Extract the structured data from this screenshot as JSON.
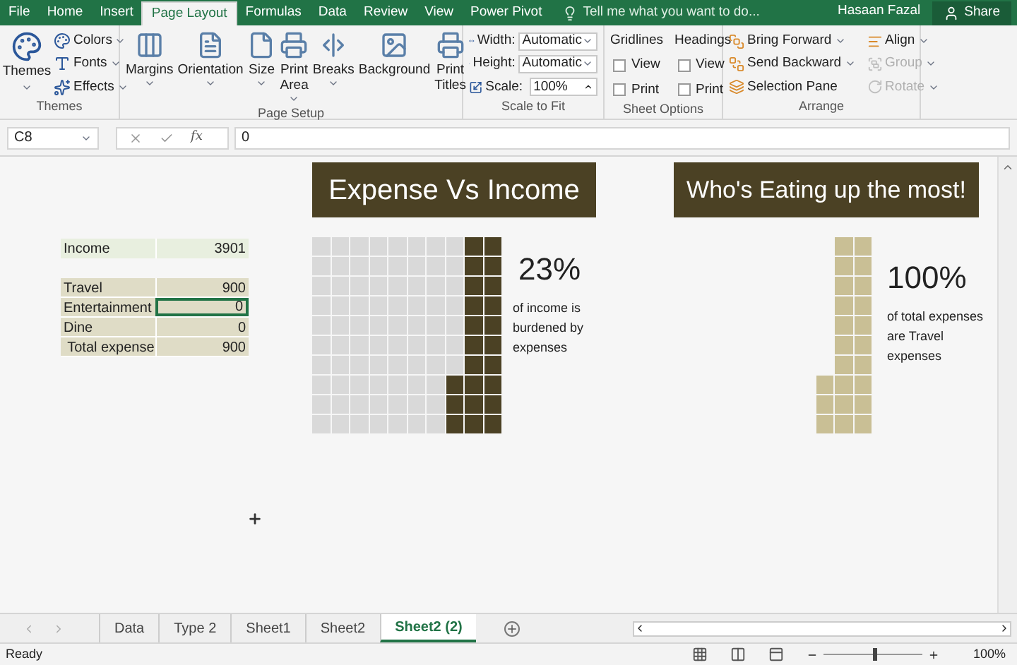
{
  "menu_tabs": [
    {
      "label": "File",
      "selected": false
    },
    {
      "label": "Home",
      "selected": false
    },
    {
      "label": "Insert",
      "selected": false
    },
    {
      "label": "Page Layout",
      "selected": true
    },
    {
      "label": "Formulas",
      "selected": false
    },
    {
      "label": "Data",
      "selected": false
    },
    {
      "label": "Review",
      "selected": false
    },
    {
      "label": "View",
      "selected": false
    },
    {
      "label": "Power Pivot",
      "selected": false
    }
  ],
  "tell_me": {
    "placeholder": "Tell me what you want to do..."
  },
  "user": "Hasaan Fazal",
  "share": "Share",
  "ribbon": {
    "themes": {
      "label": "Themes",
      "button": "Themes",
      "items": [
        "Colors",
        "Fonts",
        "Effects"
      ]
    },
    "page_setup": {
      "label": "Page Setup",
      "buttons": [
        {
          "label": "Margins",
          "dropdown": true
        },
        {
          "label": "Orientation",
          "dropdown": true
        },
        {
          "label": "Size",
          "dropdown": true
        },
        {
          "label": "Print Area",
          "dropdown": true
        },
        {
          "label": "Breaks",
          "dropdown": true
        },
        {
          "label": "Background",
          "dropdown": false
        },
        {
          "label": "Print Titles",
          "dropdown": false
        }
      ]
    },
    "scale_to_fit": {
      "label": "Scale to Fit",
      "rows": [
        {
          "kind": "select",
          "label": "Width:",
          "value": "Automatic"
        },
        {
          "kind": "select",
          "label": "Height:",
          "value": "Automatic"
        },
        {
          "kind": "spin",
          "label": "Scale:",
          "value": "100%"
        }
      ]
    },
    "sheet_options": {
      "label": "Sheet Options",
      "columns": [
        {
          "heading": "Gridlines",
          "options": [
            {
              "label": "View",
              "checked": false
            },
            {
              "label": "Print",
              "checked": false
            }
          ]
        },
        {
          "heading": "Headings",
          "options": [
            {
              "label": "View",
              "checked": false
            },
            {
              "label": "Print",
              "checked": false
            }
          ]
        }
      ]
    },
    "arrange": {
      "label": "Arrange",
      "items": [
        {
          "label": "Bring Forward",
          "disabled": false
        },
        {
          "label": "Send Backward",
          "disabled": false
        },
        {
          "label": "Selection Pane",
          "disabled": false
        },
        {
          "label": "Align",
          "disabled": false
        },
        {
          "label": "Group",
          "disabled": true
        },
        {
          "label": "Rotate",
          "disabled": true
        }
      ]
    }
  },
  "formula_bar": {
    "name_box": "C8",
    "function": "fx",
    "value": "0"
  },
  "table": {
    "income": {
      "label": "Income",
      "value": "3901"
    },
    "rows": [
      {
        "label": "Travel",
        "value": "900",
        "selected": false
      },
      {
        "label": "Entertainment",
        "value": "0",
        "selected": true
      },
      {
        "label": "Dine",
        "value": "0",
        "selected": false
      },
      {
        "label": " Total expense",
        "value": "900",
        "selected": false
      }
    ]
  },
  "panels": [
    {
      "title": "Expense Vs Income",
      "kind": "full",
      "big": "23%",
      "caption": "of income is burdened by expenses"
    },
    {
      "title": "Who's Eating up the most!",
      "kind": "filled-only",
      "big": "100%",
      "caption": "of total expenses are Travel expenses"
    }
  ],
  "sheet_tabs": [
    {
      "label": "Data",
      "selected": false
    },
    {
      "label": "Type 2",
      "selected": false
    },
    {
      "label": "Sheet1",
      "selected": false
    },
    {
      "label": "Sheet2",
      "selected": false
    },
    {
      "label": "Sheet2 (2)",
      "selected": true
    }
  ],
  "status": "Ready",
  "zoom": {
    "label": "100%",
    "level": 0.5
  }
}
